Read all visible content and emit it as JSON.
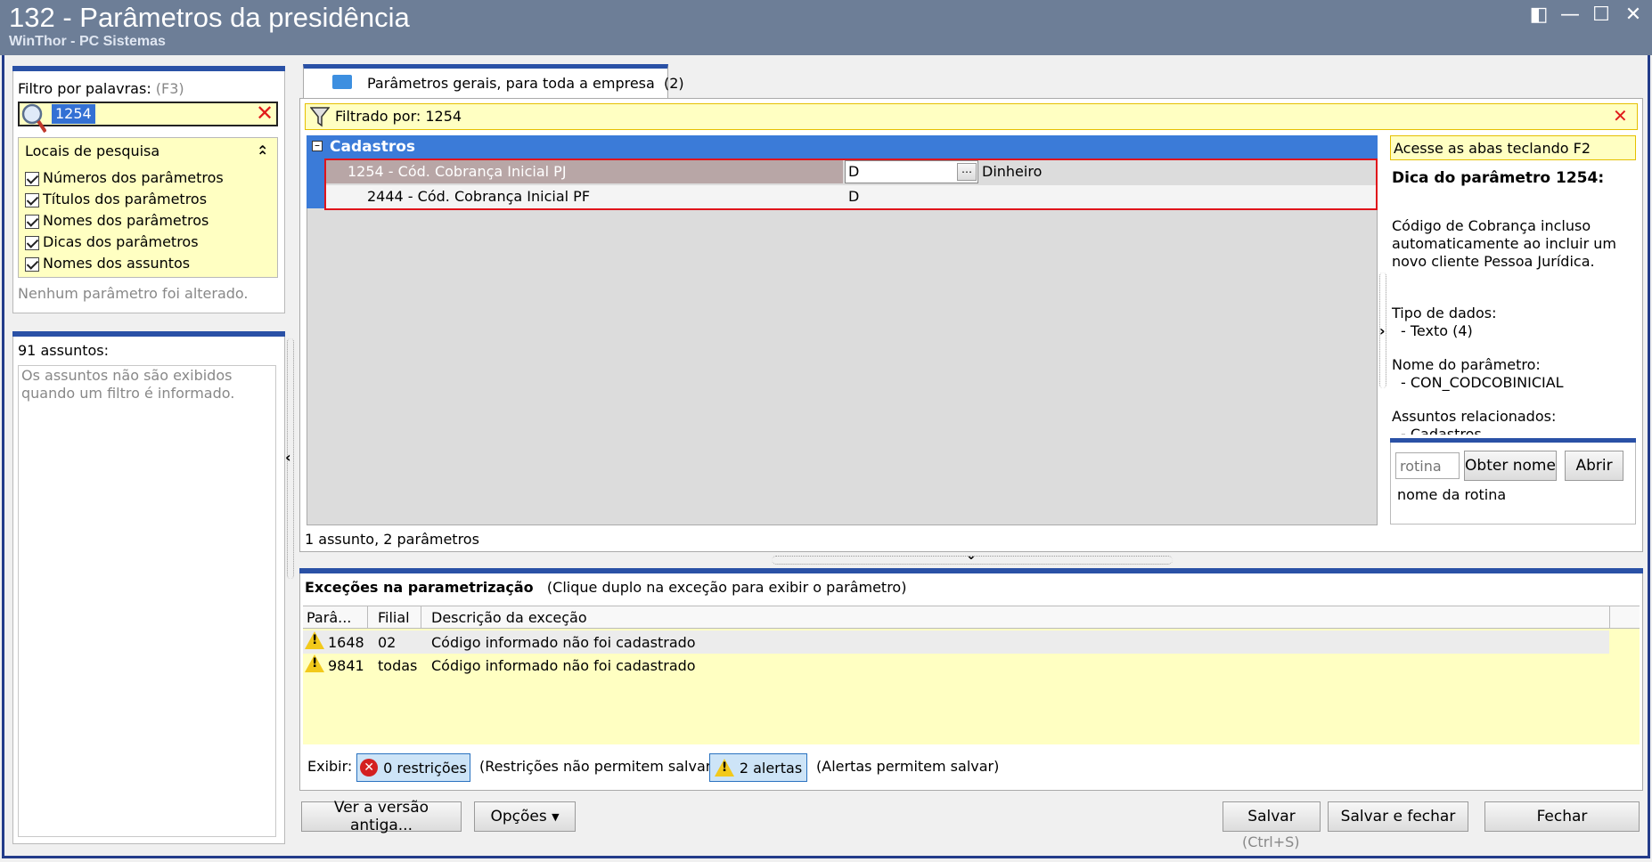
{
  "window": {
    "title": "132 - Parâmetros da presidência",
    "subtitle": "WinThor - PC Sistemas"
  },
  "filter": {
    "label": "Filtro por palavras:",
    "shortcut": "(F3)",
    "value": "1254",
    "locations_title": "Locais de pesquisa",
    "options": [
      "Números dos parâmetros",
      "Títulos dos parâmetros",
      "Nomes dos parâmetros",
      "Dicas dos parâmetros",
      "Nomes dos assuntos"
    ],
    "status": "Nenhum parâmetro foi alterado."
  },
  "subjects": {
    "count_label": "91 assuntos:",
    "empty_message": "Os assuntos não são exibidos quando um filtro é informado."
  },
  "tab": {
    "label": "Parâmetros gerais, para toda a empresa",
    "count": "(2)"
  },
  "filter_bar": {
    "text": "Filtrado por: 1254"
  },
  "grid": {
    "group": "Cadastros",
    "rows": [
      {
        "name": "1254 -  Cód. Cobrança Inicial PJ",
        "value": "D",
        "desc": "Dinheiro"
      },
      {
        "name": "2444 - Cód. Cobrança Inicial PF",
        "value": "D",
        "desc": ""
      }
    ],
    "footer": "1 assunto, 2 parâmetros"
  },
  "tip": {
    "hint": "Acesse as abas teclando F2",
    "title": "Dica do parâmetro 1254:",
    "description": "Código de Cobrança incluso automaticamente ao incluir um novo cliente Pessoa Jurídica.",
    "type_label": "Tipo de dados:",
    "type_value": "- Texto (4)",
    "name_label": "Nome do parâmetro:",
    "name_value": "- CON_CODCOBINICIAL",
    "subjects_label": "Assuntos relacionados:",
    "subjects_value": "- Cadastros"
  },
  "routine": {
    "placeholder": "rotina",
    "get_name": "Obter nome",
    "open": "Abrir",
    "name_label": "nome da rotina"
  },
  "exceptions": {
    "title": "Exceções na parametrização",
    "subtitle": "(Clique duplo na exceção para exibir o parâmetro)",
    "columns": [
      "Parâ...",
      "Filial",
      "Descrição da exceção"
    ],
    "rows": [
      {
        "param": "1648",
        "branch": "02",
        "desc": "Código informado não foi cadastrado"
      },
      {
        "param": "9841",
        "branch": "todas",
        "desc": "Código informado não foi cadastrado"
      }
    ],
    "show_label": "Exibir:",
    "restrictions_btn": "0 restrições",
    "restrictions_note": "(Restrições não permitem salvar)",
    "alerts_btn": "2 alertas",
    "alerts_note": "(Alertas permitem salvar)"
  },
  "bottom": {
    "old_version": "Ver a versão antiga...",
    "options": "Opções",
    "save": "Salvar",
    "save_shortcut": "(Ctrl+S)",
    "save_close": "Salvar e fechar",
    "close": "Fechar"
  }
}
